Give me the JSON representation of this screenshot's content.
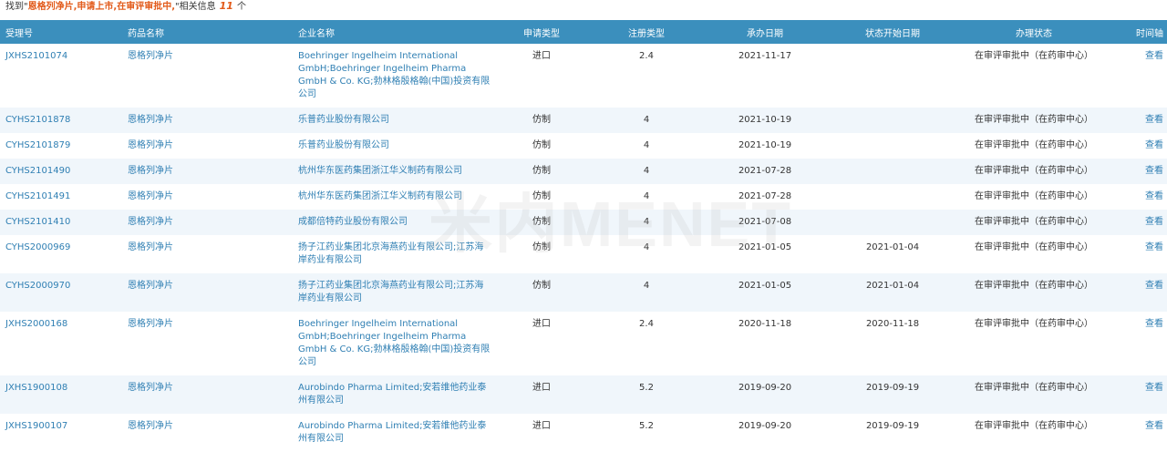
{
  "summary": {
    "prefix": "找到\"",
    "keyword": "恩格列净片,申请上市,在审评审批中,",
    "middle": "\"相关信息",
    "count": "11",
    "suffix": "个"
  },
  "columns": [
    "受理号",
    "药品名称",
    "企业名称",
    "申请类型",
    "注册类型",
    "承办日期",
    "状态开始日期",
    "办理状态",
    "时间轴"
  ],
  "rows": [
    {
      "id": "JXHS2101074",
      "drug": "恩格列净片",
      "company": "Boehringer Ingelheim International GmbH;Boehringer Ingelheim Pharma GmbH & Co. KG;勃林格殷格翰(中国)投资有限公司",
      "app": "进口",
      "reg": "2.4",
      "date": "2021-11-17",
      "start": "",
      "status": "在审评审批中（在药审中心）",
      "action": "查看"
    },
    {
      "id": "CYHS2101878",
      "drug": "恩格列净片",
      "company": "乐普药业股份有限公司",
      "app": "仿制",
      "reg": "4",
      "date": "2021-10-19",
      "start": "",
      "status": "在审评审批中（在药审中心）",
      "action": "查看"
    },
    {
      "id": "CYHS2101879",
      "drug": "恩格列净片",
      "company": "乐普药业股份有限公司",
      "app": "仿制",
      "reg": "4",
      "date": "2021-10-19",
      "start": "",
      "status": "在审评审批中（在药审中心）",
      "action": "查看"
    },
    {
      "id": "CYHS2101490",
      "drug": "恩格列净片",
      "company": "杭州华东医药集团浙江华义制药有限公司",
      "app": "仿制",
      "reg": "4",
      "date": "2021-07-28",
      "start": "",
      "status": "在审评审批中（在药审中心）",
      "action": "查看"
    },
    {
      "id": "CYHS2101491",
      "drug": "恩格列净片",
      "company": "杭州华东医药集团浙江华义制药有限公司",
      "app": "仿制",
      "reg": "4",
      "date": "2021-07-28",
      "start": "",
      "status": "在审评审批中（在药审中心）",
      "action": "查看"
    },
    {
      "id": "CYHS2101410",
      "drug": "恩格列净片",
      "company": "成都倍特药业股份有限公司",
      "app": "仿制",
      "reg": "4",
      "date": "2021-07-08",
      "start": "",
      "status": "在审评审批中（在药审中心）",
      "action": "查看"
    },
    {
      "id": "CYHS2000969",
      "drug": "恩格列净片",
      "company": "扬子江药业集团北京海燕药业有限公司;江苏海岸药业有限公司",
      "app": "仿制",
      "reg": "4",
      "date": "2021-01-05",
      "start": "2021-01-04",
      "status": "在审评审批中（在药审中心）",
      "action": "查看"
    },
    {
      "id": "CYHS2000970",
      "drug": "恩格列净片",
      "company": "扬子江药业集团北京海燕药业有限公司;江苏海岸药业有限公司",
      "app": "仿制",
      "reg": "4",
      "date": "2021-01-05",
      "start": "2021-01-04",
      "status": "在审评审批中（在药审中心）",
      "action": "查看"
    },
    {
      "id": "JXHS2000168",
      "drug": "恩格列净片",
      "company": "Boehringer Ingelheim International GmbH;Boehringer Ingelheim Pharma GmbH & Co. KG;勃林格殷格翰(中国)投资有限公司",
      "app": "进口",
      "reg": "2.4",
      "date": "2020-11-18",
      "start": "2020-11-18",
      "status": "在审评审批中（在药审中心）",
      "action": "查看"
    },
    {
      "id": "JXHS1900108",
      "drug": "恩格列净片",
      "company": "Aurobindo Pharma Limited;安若维他药业泰州有限公司",
      "app": "进口",
      "reg": "5.2",
      "date": "2019-09-20",
      "start": "2019-09-19",
      "status": "在审评审批中（在药审中心）",
      "action": "查看"
    },
    {
      "id": "JXHS1900107",
      "drug": "恩格列净片",
      "company": "Aurobindo Pharma Limited;安若维他药业泰州有限公司",
      "app": "进口",
      "reg": "5.2",
      "date": "2019-09-20",
      "start": "2019-09-19",
      "status": "在审评审批中（在药审中心）",
      "action": "查看"
    }
  ],
  "watermark": "米内MENET"
}
